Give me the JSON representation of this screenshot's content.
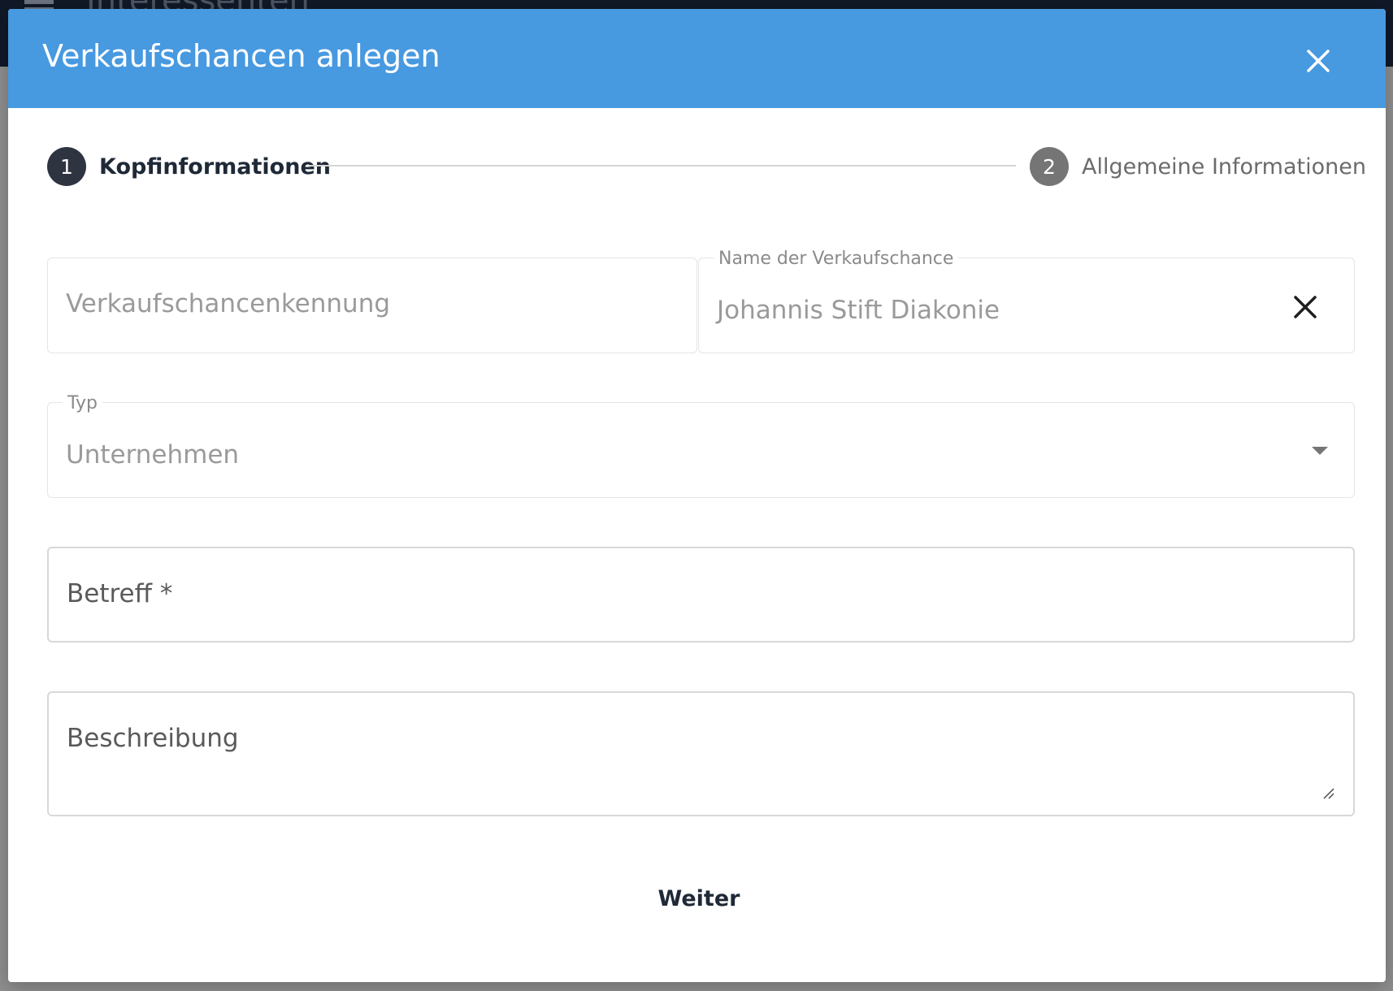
{
  "background": {
    "page_title": "Interessenten"
  },
  "modal": {
    "title": "Verkaufschancen anlegen",
    "header_color": "#4799e0",
    "close_icon": "close-icon"
  },
  "stepper": {
    "steps": [
      {
        "number": "1",
        "label": "Kopfinformationen",
        "active": true
      },
      {
        "number": "2",
        "label": "Allgemeine Informationen",
        "active": false
      }
    ]
  },
  "form": {
    "kennung": {
      "placeholder": "Verkaufschancenkennung"
    },
    "name": {
      "label": "Name der Verkaufschance",
      "value": "Johannis Stift Diakonie",
      "clear_icon": "close-icon"
    },
    "typ": {
      "label": "Typ",
      "value": "Unternehmen",
      "dropdown_icon": "chevron-down-icon"
    },
    "betreff": {
      "label": "Betreff *"
    },
    "beschreibung": {
      "label": "Beschreibung"
    }
  },
  "actions": {
    "next_label": "Weiter"
  }
}
